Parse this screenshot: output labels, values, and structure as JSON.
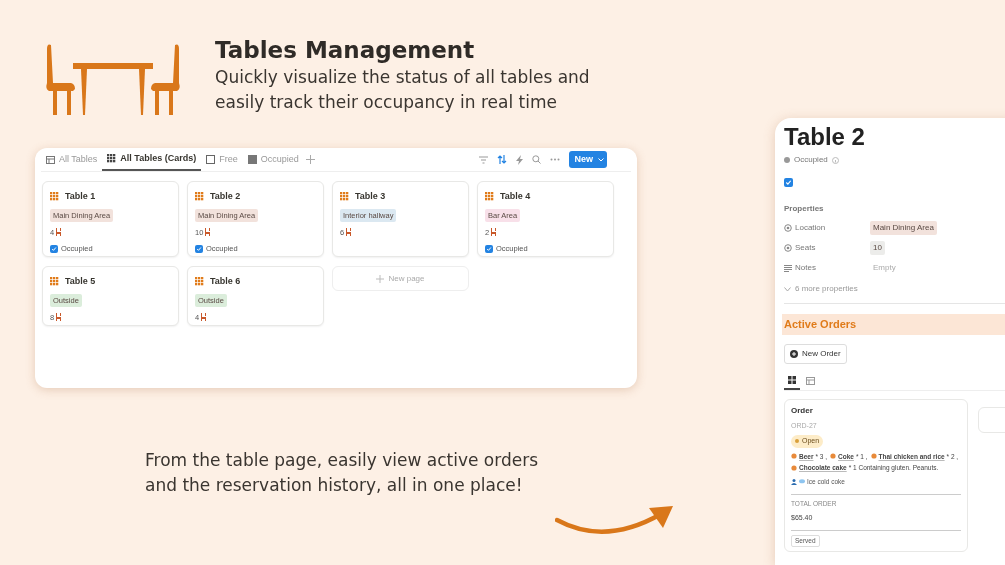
{
  "header": {
    "title": "Tables Management",
    "subtitle": [
      "Quickly visualize the status of all tables and",
      "easily track their occupancy in real time"
    ]
  },
  "board": {
    "tabs": [
      {
        "kind": "table",
        "label": "All Tables",
        "selected": false
      },
      {
        "kind": "cards",
        "label": "All Tables (Cards)",
        "selected": true
      },
      {
        "kind": "free",
        "label": "Free",
        "selected": false
      },
      {
        "kind": "occupied",
        "label": "Occupied",
        "selected": false
      }
    ],
    "toolbar": [
      {
        "kind": "filter",
        "active": false
      },
      {
        "kind": "sort",
        "active": true
      },
      {
        "kind": "automation",
        "active": false
      },
      {
        "kind": "search",
        "active": false
      },
      {
        "kind": "more",
        "active": false
      }
    ],
    "new_button": "New",
    "cards": [
      {
        "title": "Table 1",
        "location": "Main Dining Area",
        "color": "#f2e2dc",
        "seats": "4",
        "occupied": true,
        "occupied_label": "Occupied"
      },
      {
        "title": "Table 2",
        "location": "Main Dining Area",
        "color": "#f2e2dc",
        "seats": "10",
        "occupied": true,
        "occupied_label": "Occupied"
      },
      {
        "title": "Table 3",
        "location": "Interior hallway",
        "color": "#dbe8f1",
        "seats": "6",
        "occupied": false
      },
      {
        "title": "Table 4",
        "location": "Bar Area",
        "color": "#f8e0e9",
        "seats": "2",
        "occupied": true,
        "occupied_label": "Occupied"
      },
      {
        "title": "Table 5",
        "location": "Outside",
        "color": "#dbeddb",
        "seats": "8",
        "occupied": false
      },
      {
        "title": "Table 6",
        "location": "Outside",
        "color": "#dbeddb",
        "seats": "4",
        "occupied": false
      }
    ],
    "new_page": "New page"
  },
  "caption": [
    "From the table page, easily view active orders",
    "and the reservation history, all in one place!"
  ],
  "table_page": {
    "title": "Table 2",
    "status_label": "Occupied",
    "checked": true,
    "properties_heading": "Properties",
    "properties": [
      {
        "kind": "tag",
        "label": "Location",
        "value": "Main Dining Area",
        "color": "#f2e2dc"
      },
      {
        "kind": "number",
        "label": "Seats",
        "value": "10",
        "color": "#ececea"
      },
      {
        "kind": "text",
        "label": "Notes",
        "value": "Empty",
        "color": "#ffffff"
      }
    ],
    "more_properties": "6 more properties",
    "orders_heading": "Active Orders",
    "new_order": "New Order",
    "views": [
      {
        "kind": "board",
        "selected": true
      },
      {
        "kind": "table",
        "selected": false
      }
    ],
    "order": {
      "title": "Order",
      "id": "ORD-27",
      "status": "Open",
      "items": [
        {
          "name": "Beer",
          "suffix": "* 3 ,"
        },
        {
          "name": "Coke",
          "suffix": "* 1 ,"
        },
        {
          "name": "Thai chicken and rice",
          "suffix": "* 2 ,"
        },
        {
          "name": "Chocolate cake",
          "suffix": "* 1 Containing gluten. Peanuts."
        }
      ],
      "note": "Ice cold coke",
      "total_label": "TOTAL ORDER",
      "total": "$65.40",
      "served": "Served"
    }
  }
}
